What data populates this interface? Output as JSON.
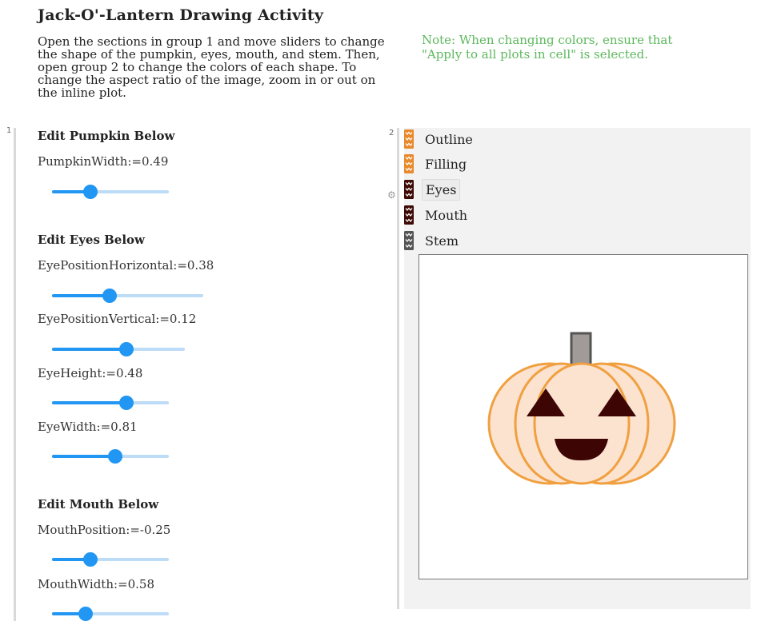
{
  "header": {
    "title": "Jack-O'-Lantern Drawing Activity",
    "instructions": "Open the sections in group 1 and move sliders to change the shape of the pumpkin, eyes, mouth, and stem. Then, open group 2 to change the colors of each shape. To change the aspect ratio of the image, zoom in or out on the inline plot.",
    "note": "Note: When changing colors, ensure that \"Apply to all plots in cell\" is selected."
  },
  "group1": {
    "number": "1",
    "pumpkin": {
      "heading": "Edit Pumpkin Below",
      "width_label": "PumpkinWidth:=0.49",
      "width_level": 0.33
    },
    "eyes": {
      "heading": "Edit Eyes Below",
      "horizontal_label": "EyePositionHorizontal:=0.38",
      "horizontal_level": 0.38,
      "vertical_label": "EyePositionVertical:=0.12",
      "vertical_level": 0.56,
      "height_label": "EyeHeight:=0.48",
      "height_level": 0.64,
      "width_label": "EyeWidth:=0.81",
      "width_level": 0.54
    },
    "mouth": {
      "heading": "Edit Mouth Below",
      "position_label": "MouthPosition:=-0.25",
      "position_level": 0.33,
      "width_label": "MouthWidth:=0.58",
      "width_level": 0.29
    }
  },
  "group2": {
    "number": "2",
    "folders": [
      {
        "label": "Outline",
        "icon": "orange-folder-icon",
        "color": "#e8892b"
      },
      {
        "label": "Filling",
        "icon": "orange-folder-icon",
        "color": "#e8892b"
      },
      {
        "label": "Eyes",
        "icon": "darkred-folder-icon",
        "color": "#3d0a05"
      },
      {
        "label": "Mouth",
        "icon": "darkred-folder-icon",
        "color": "#3d0a05"
      },
      {
        "label": "Stem",
        "icon": "gray-folder-icon",
        "color": "#555555"
      }
    ]
  },
  "colors": {
    "outline": "#f0a040",
    "filling": "#fbe3d0",
    "eyes": "#3d0605",
    "mouth": "#3d0605",
    "stem": "#a09a98",
    "stem_outline": "#555555",
    "slider_active": "#2196f3",
    "slider_track": "#bcdcf7",
    "note": "#5cb85c"
  }
}
